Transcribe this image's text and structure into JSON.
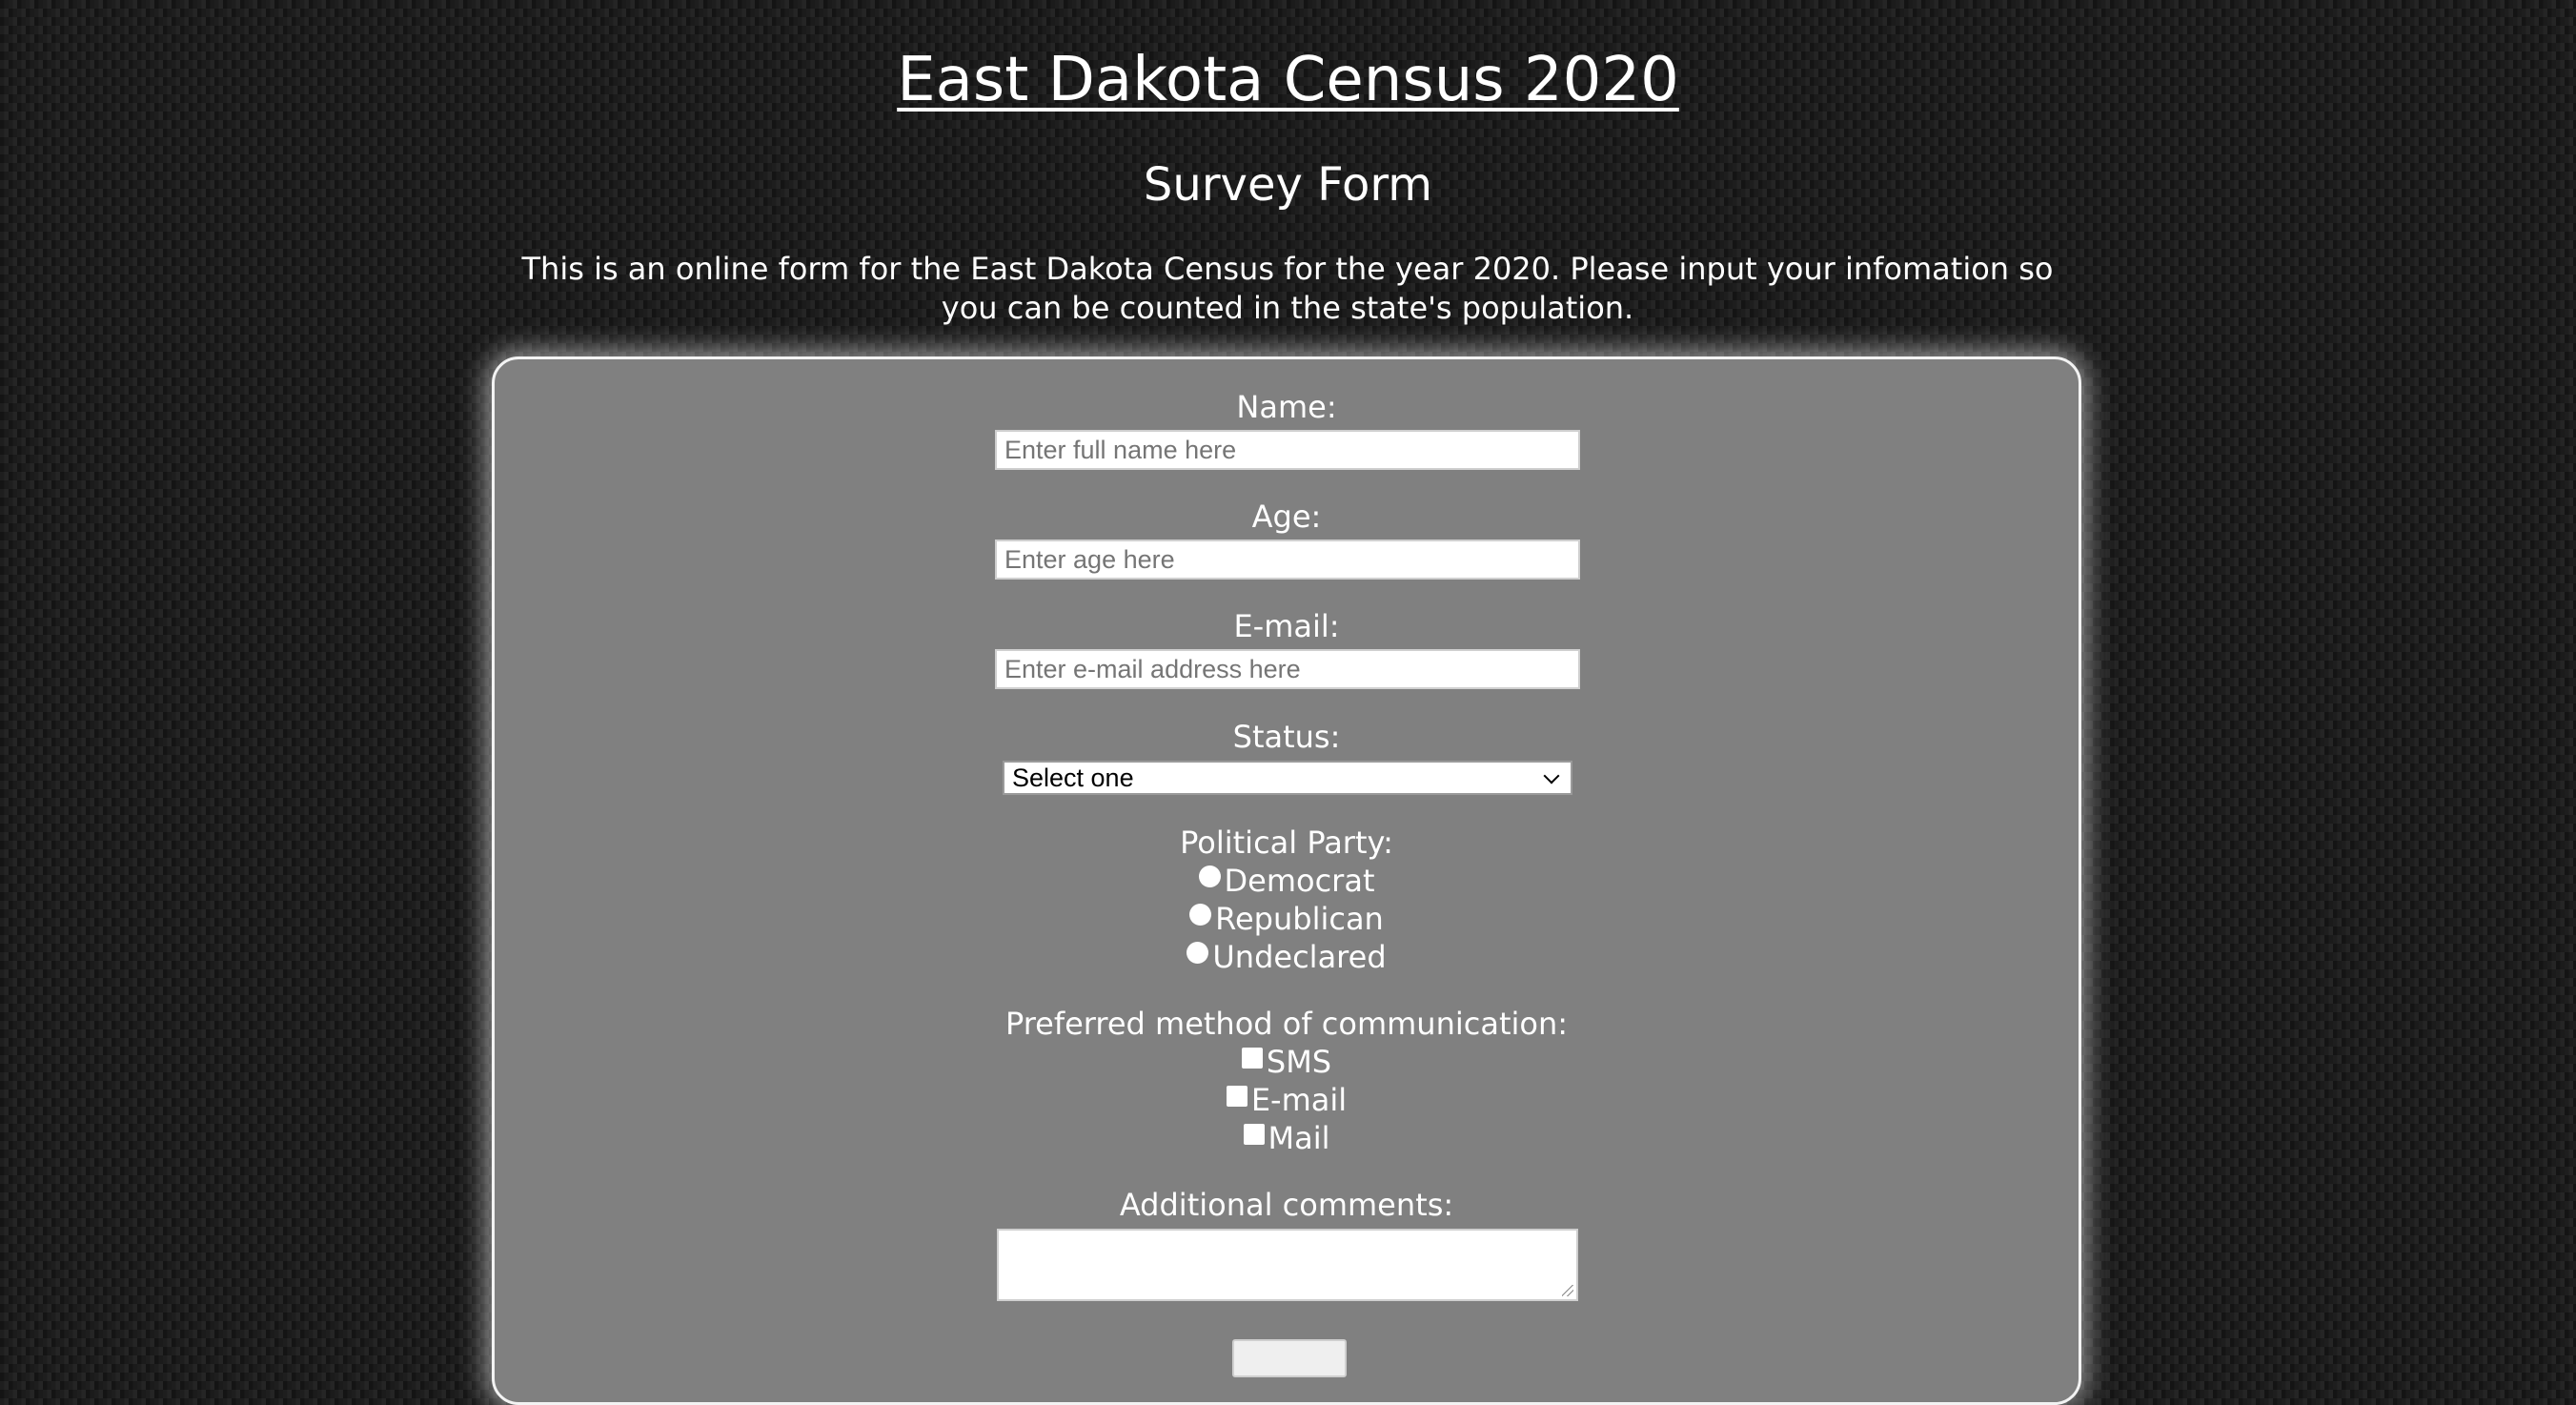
{
  "header": {
    "title": "East Dakota Census 2020",
    "subtitle": "Survey Form",
    "description": "This is an online form for the East Dakota Census for the year 2020. Please input your infomation so you can be counted in the state's population."
  },
  "form": {
    "name": {
      "label": "Name:",
      "placeholder": "Enter full name here"
    },
    "age": {
      "label": "Age:",
      "placeholder": "Enter age here"
    },
    "email": {
      "label": "E-mail:",
      "placeholder": "Enter e-mail address here"
    },
    "status": {
      "label": "Status:",
      "selected": "Select one"
    },
    "party": {
      "label": "Political Party:",
      "options": [
        "Democrat",
        "Republican",
        "Undeclared"
      ]
    },
    "communication": {
      "label": "Preferred method of communication:",
      "options": [
        "SMS",
        "E-mail",
        "Mail"
      ]
    },
    "comments": {
      "label": "Additional comments:",
      "value": ""
    },
    "submit_label": ""
  },
  "colors": {
    "card_background": "#808080",
    "page_background": "#1b1b1b",
    "text": "#ffffff"
  }
}
